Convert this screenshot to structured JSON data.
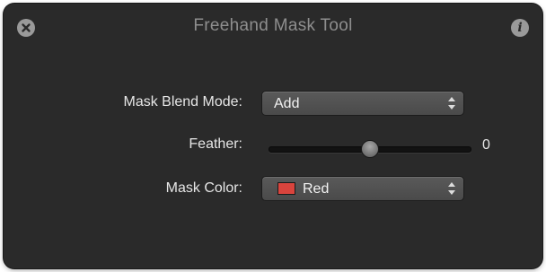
{
  "window": {
    "title": "Freehand Mask Tool"
  },
  "blend_mode": {
    "label": "Mask Blend Mode:",
    "value": "Add"
  },
  "feather": {
    "label": "Feather:",
    "value": "0",
    "level": 0.5
  },
  "mask_color": {
    "label": "Mask Color:",
    "value": "Red",
    "swatch_color": "#d9443d"
  },
  "icons": {
    "close": "close-icon",
    "info": "info-icon"
  },
  "colors": {
    "panel_background": "#2a2a2a",
    "title_text": "#8e8e8e",
    "label_text": "#e6e6e6"
  }
}
